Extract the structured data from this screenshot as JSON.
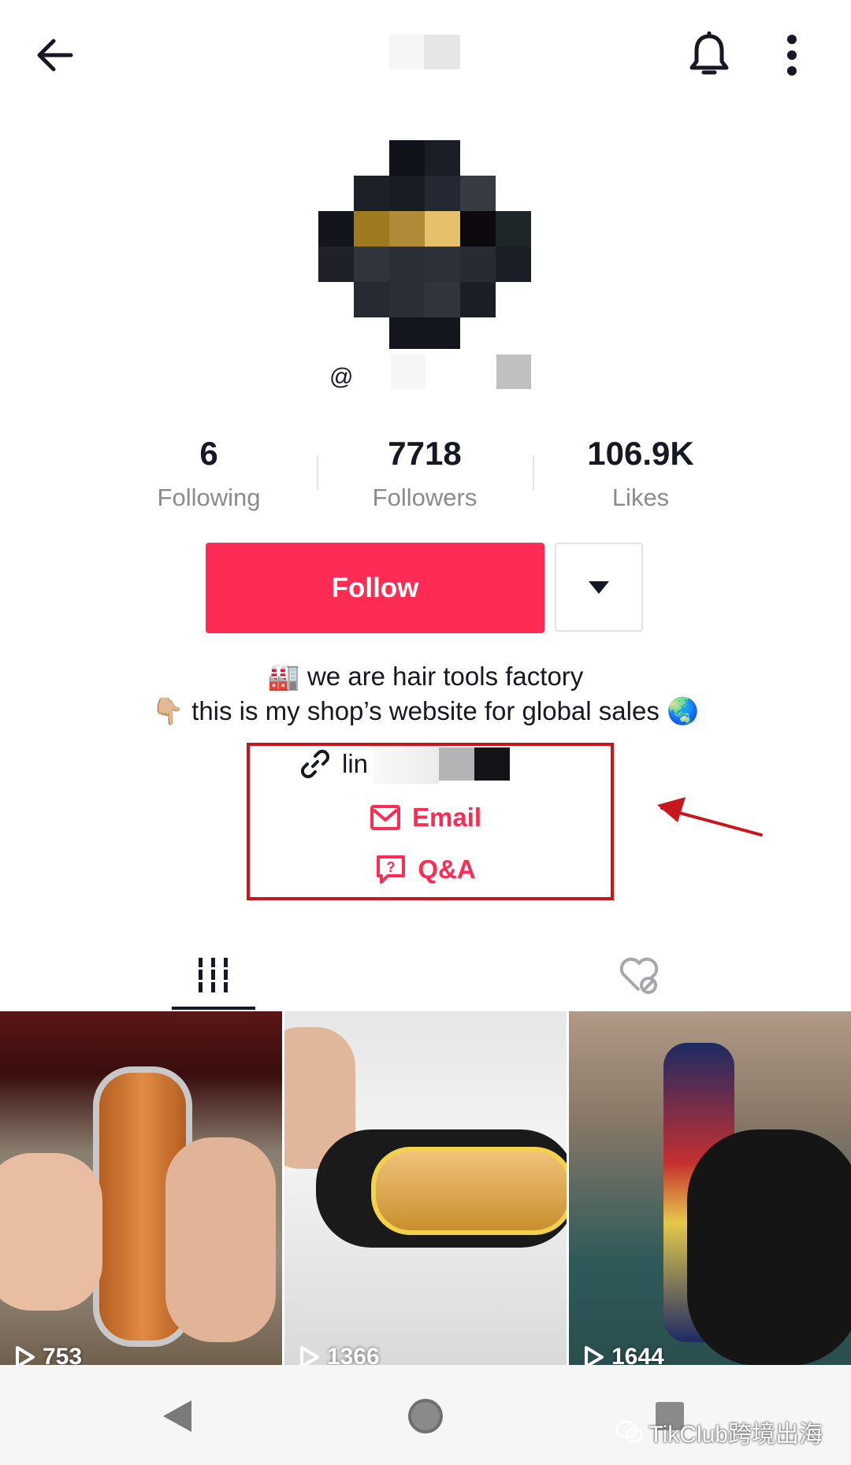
{
  "header": {
    "back_icon": "arrow-left-icon",
    "notification_icon": "bell-icon",
    "more_icon": "more-vertical-icon"
  },
  "profile": {
    "handle_prefix": "@"
  },
  "stats": [
    {
      "value": "6",
      "label": "Following"
    },
    {
      "value": "7718",
      "label": "Followers"
    },
    {
      "value": "106.9K",
      "label": "Likes"
    }
  ],
  "actions": {
    "follow_label": "Follow",
    "dropdown_icon": "caret-down-icon"
  },
  "bio": {
    "line1_emoji": "🏭",
    "line1_text": "we are hair tools factory",
    "line2_emoji": "👇🏼",
    "line2_text": "this is my shop’s website for global sales",
    "line2_end_emoji": "🌏"
  },
  "links": {
    "link_text": "lin",
    "email_label": "Email",
    "qa_label": "Q&A"
  },
  "tabs": [
    {
      "icon": "videos-grid-icon",
      "active": true
    },
    {
      "icon": "liked-hidden-icon",
      "active": false
    }
  ],
  "videos": [
    {
      "views": "753"
    },
    {
      "views": "1366"
    },
    {
      "views": "1644"
    }
  ],
  "system_nav": {
    "back_icon": "nav-back-icon",
    "home_icon": "nav-home-icon",
    "recents_icon": "nav-recents-icon"
  },
  "watermark": {
    "text": "TikClub跨境出海"
  },
  "colors": {
    "accent": "#fe2c55",
    "annotation": "#c8161d"
  }
}
